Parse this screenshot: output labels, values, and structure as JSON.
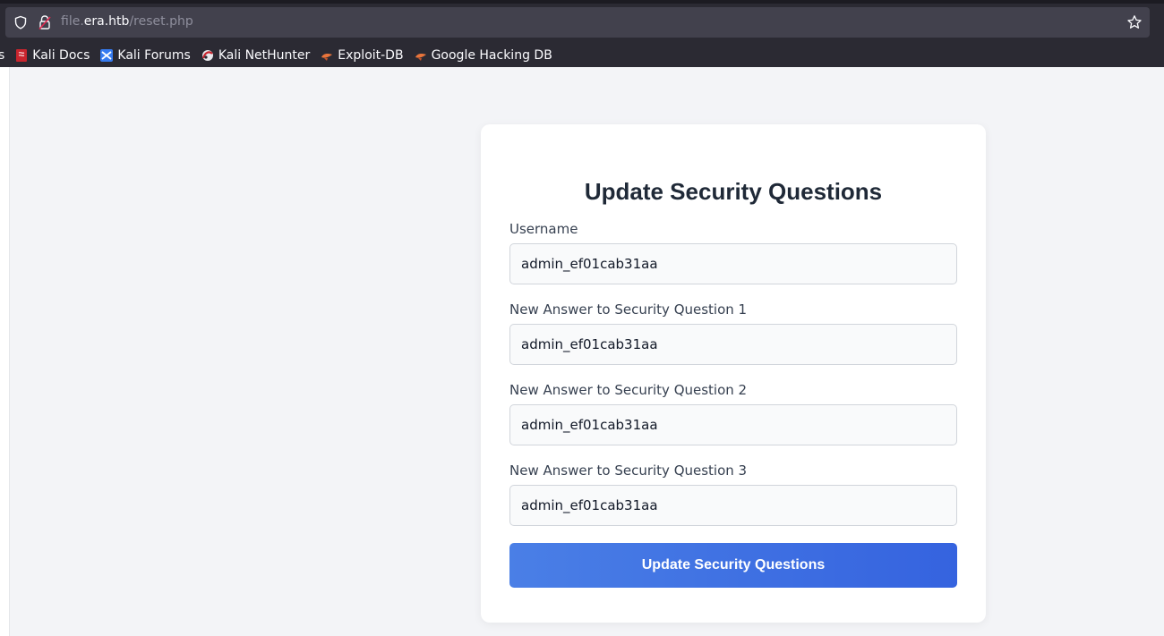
{
  "browser": {
    "url_prefix": "file.",
    "url_host": "era.htb",
    "url_path": "/reset.php",
    "bookmarks_cut": "s",
    "bookmarks": [
      {
        "label": "Kali Docs",
        "icon": "kali-docs-icon"
      },
      {
        "label": "Kali Forums",
        "icon": "kali-forums-icon"
      },
      {
        "label": "Kali NetHunter",
        "icon": "kali-nethunter-icon"
      },
      {
        "label": "Exploit-DB",
        "icon": "exploit-db-icon"
      },
      {
        "label": "Google Hacking DB",
        "icon": "google-hacking-db-icon"
      }
    ]
  },
  "form": {
    "title": "Update Security Questions",
    "fields": [
      {
        "label": "Username",
        "value": "admin_ef01cab31aa"
      },
      {
        "label": "New Answer to Security Question 1",
        "value": "admin_ef01cab31aa"
      },
      {
        "label": "New Answer to Security Question 2",
        "value": "admin_ef01cab31aa"
      },
      {
        "label": "New Answer to Security Question 3",
        "value": "admin_ef01cab31aa"
      }
    ],
    "submit_label": "Update Security Questions"
  },
  "colors": {
    "accent": "#3b6fe2",
    "page_bg": "#f3f4f7",
    "chrome_bg": "#2b2a33"
  }
}
